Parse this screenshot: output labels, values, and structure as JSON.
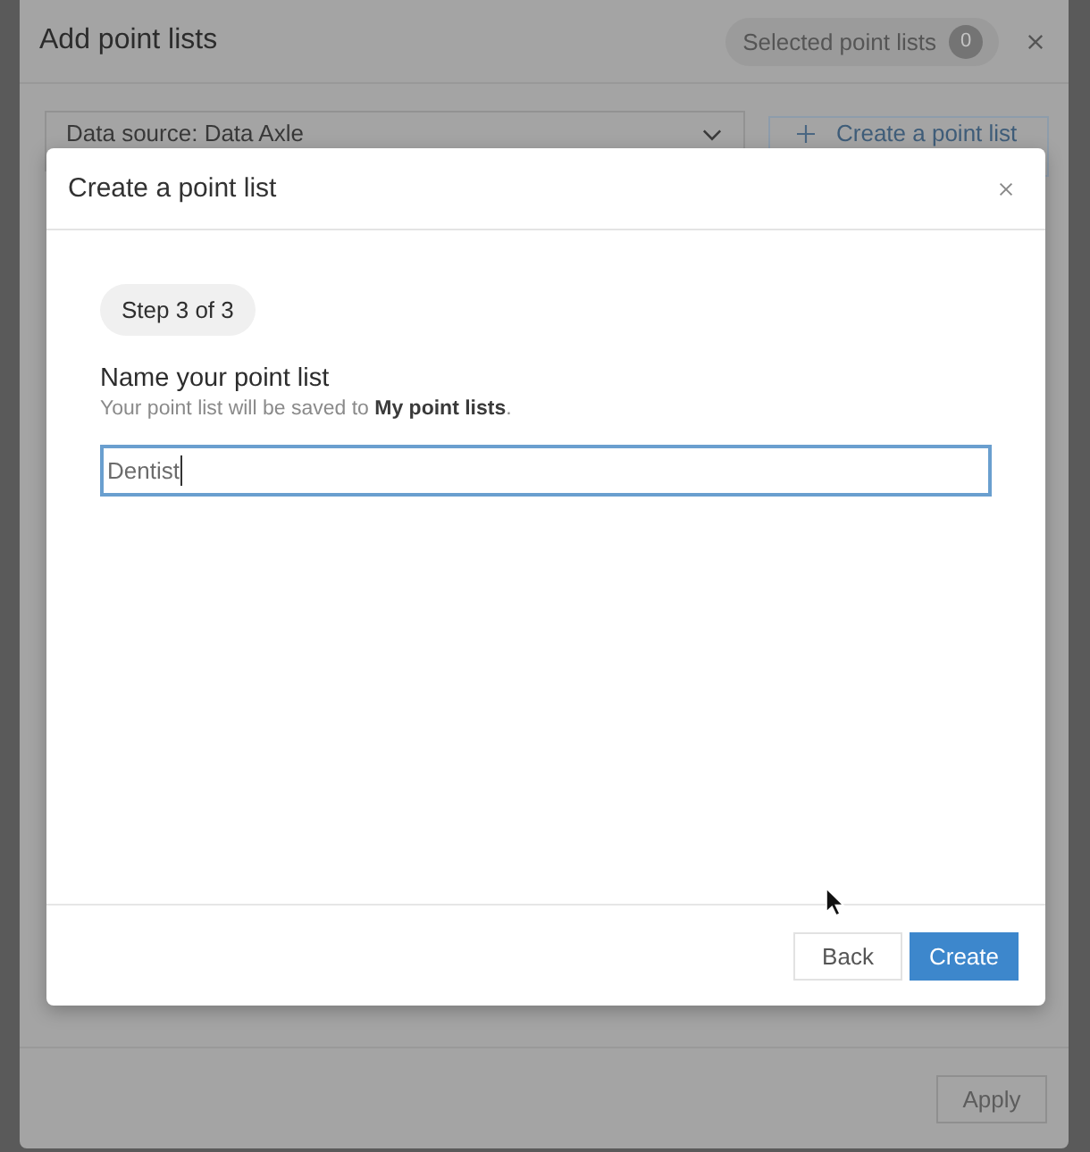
{
  "background_dialog": {
    "title": "Add point lists",
    "selected_badge": {
      "label": "Selected point lists",
      "count": "0"
    },
    "data_source": {
      "value": "Data source: Data Axle"
    },
    "create_button": {
      "label": "Create a point list"
    },
    "apply_button": {
      "label": "Apply",
      "disabled": true
    }
  },
  "modal": {
    "title": "Create a point list",
    "step": "Step 3 of 3",
    "field_label": "Name your point list",
    "hint": "Your point list will be saved to **My point lists**.",
    "name_field": {
      "value": "Dentist",
      "focused": true
    },
    "buttons": [
      {
        "label": "Back",
        "kind": "secondary"
      },
      {
        "label": "Create",
        "kind": "primary"
      }
    ]
  }
}
